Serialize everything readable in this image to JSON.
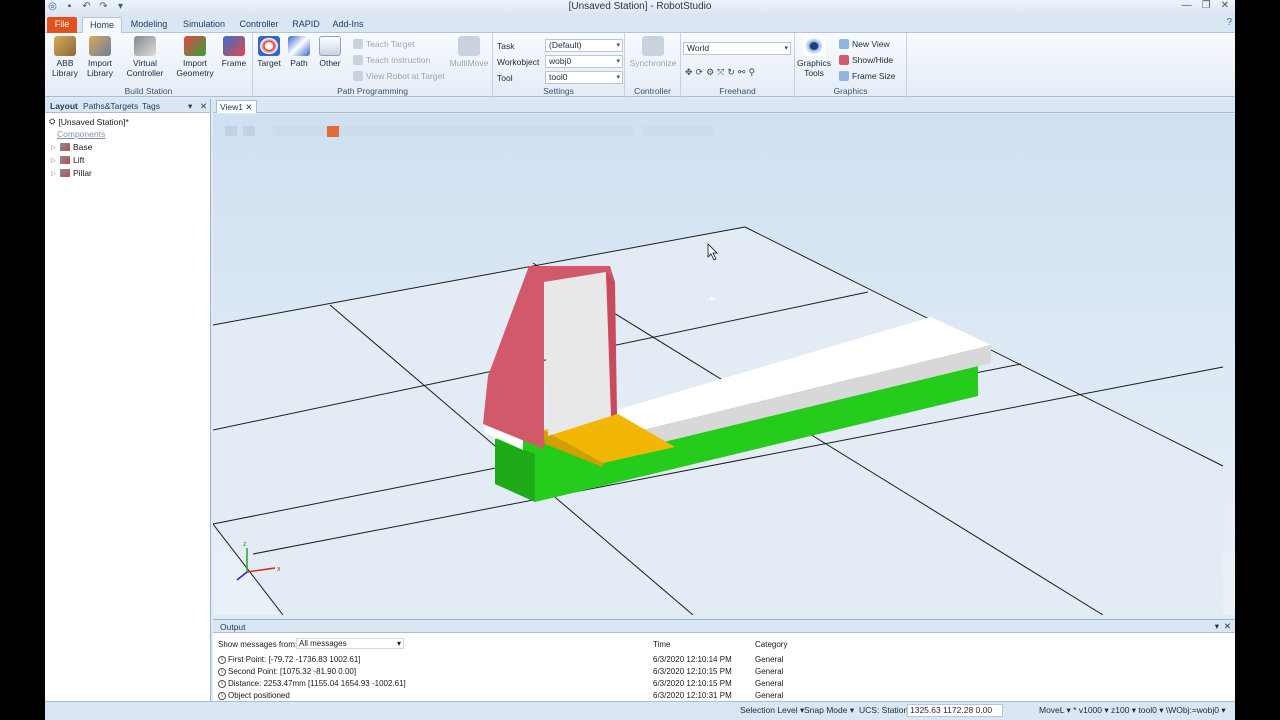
{
  "window": {
    "title": "[Unsaved Station] - RobotStudio"
  },
  "tabs": [
    "File",
    "Home",
    "Modeling",
    "Simulation",
    "Controller",
    "RAPID",
    "Add-Ins"
  ],
  "ribbon": {
    "build_station": {
      "label": "Build Station",
      "abb_library": "ABB Library",
      "import_library": "Import Library",
      "virtual_controller": "Virtual Controller",
      "import_geometry": "Import Geometry",
      "frame": "Frame"
    },
    "path_programming": {
      "label": "Path Programming",
      "target": "Target",
      "path": "Path",
      "other": "Other",
      "teach_target": "Teach Target",
      "teach_instruction": "Teach Instruction",
      "view_robot_at_target": "View Robot at Target",
      "multimove": "MultiMove"
    },
    "settings": {
      "label": "Settings",
      "task_label": "Task",
      "task_value": "(Default)",
      "workobject_label": "Workobject",
      "workobject_value": "wobj0",
      "tool_label": "Tool",
      "tool_value": "tool0"
    },
    "controller": {
      "label": "Controller",
      "synchronize": "Synchronize"
    },
    "freehand": {
      "label": "Freehand",
      "reference": "World"
    },
    "graphics": {
      "label": "Graphics",
      "graphics_tools": "Graphics Tools",
      "new_view": "New View",
      "show_hide": "Show/Hide",
      "frame_size": "Frame Size"
    }
  },
  "left_panel": {
    "tabs": [
      "Layout",
      "Paths&Targets",
      "Tags"
    ],
    "station": "[Unsaved Station]*",
    "components_label": "Components",
    "components": [
      "Base",
      "Lift",
      "Pillar"
    ]
  },
  "view": {
    "tab": "View1"
  },
  "output": {
    "title": "Output",
    "filter_label": "Show messages from:",
    "filter_value": "All messages",
    "col_time": "Time",
    "col_category": "Category",
    "rows": [
      {
        "msg": "First Point: [-79.72 -1736.83 1002.61]",
        "time": "6/3/2020 12:10:14 PM",
        "cat": "General"
      },
      {
        "msg": "Second Point: [1075.32 -81.90 0.00]",
        "time": "6/3/2020 12:10:15 PM",
        "cat": "General"
      },
      {
        "msg": "Distance: 2253.47mm [1155.04 1654.93 -1002.61]",
        "time": "6/3/2020 12:10:15 PM",
        "cat": "General"
      },
      {
        "msg": "Object positioned",
        "time": "6/3/2020 12:10:31 PM",
        "cat": "General"
      }
    ]
  },
  "statusbar": {
    "selection_level": "Selection Level ▾",
    "snap_mode": "Snap Mode ▾",
    "ucs": "UCS: Station",
    "coords": "1325.63  1172.28  0.00",
    "instruction": "MoveL ▾  *  v1000 ▾  z100 ▾  tool0 ▾  \\WObj:=wobj0 ▾"
  },
  "colors": {
    "file_tab": "#e3521d",
    "floor": "#e3ecf5",
    "lift_green": "#26cc1c",
    "pillar_red": "#d2596a",
    "plate_yellow": "#f2b705"
  }
}
